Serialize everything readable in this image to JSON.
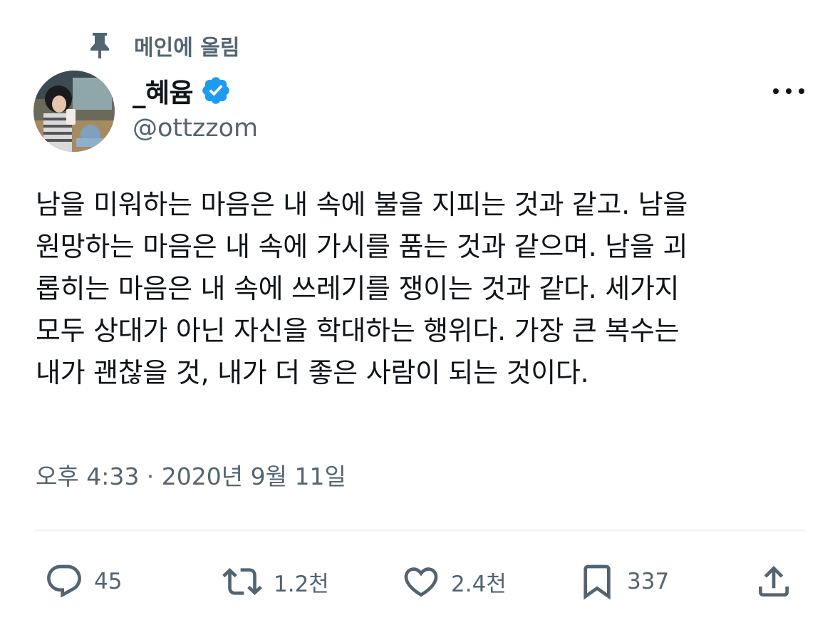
{
  "pinned": {
    "label": "메인에 올림",
    "icon": "pin-icon"
  },
  "author": {
    "display_name": "_혜윰",
    "handle": "@ottzzom",
    "verified": true,
    "verified_icon": "verified-badge-icon",
    "verified_color": "#1d9bf0"
  },
  "more_icon": "more-horizontal-icon",
  "tweet": {
    "lines": [
      "남을 미워하는 마음은 내 속에 불을 지피는 것과 같고. 남을",
      "원망하는 마음은 내 속에 가시를 품는 것과 같으며. 남을 괴",
      "롭히는 마음은 내 속에 쓰레기를 쟁이는 것과 같다. 세가지",
      "모두 상대가 아닌 자신을 학대하는 행위다. 가장 큰 복수는",
      "내가 괜찮을 것, 내가 더 좋은 사람이 되는 것이다."
    ],
    "timestamp": "오후 4:33 · 2020년 9월 11일"
  },
  "actions": {
    "reply": {
      "icon": "reply-icon",
      "count": "45"
    },
    "retweet": {
      "icon": "retweet-icon",
      "count": "1.2천"
    },
    "like": {
      "icon": "heart-icon",
      "count": "2.4천"
    },
    "bookmark": {
      "icon": "bookmark-icon",
      "count": "337"
    },
    "share": {
      "icon": "share-icon"
    }
  },
  "colors": {
    "text_primary": "#0f1419",
    "text_secondary": "#536471",
    "divider": "#eff3f4",
    "accent": "#1d9bf0"
  }
}
